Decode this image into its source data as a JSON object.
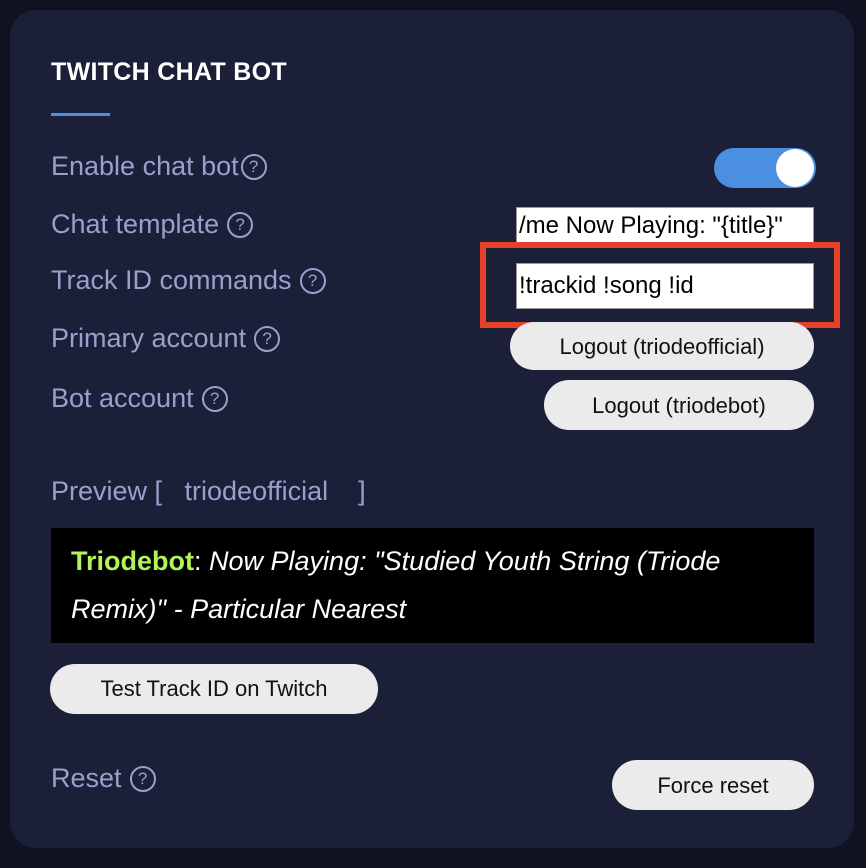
{
  "panel": {
    "title": "TWITCH CHAT BOT"
  },
  "settings": {
    "enable_chat_bot": {
      "label": "Enable chat bot",
      "enabled": true
    },
    "chat_template": {
      "label": "Chat template",
      "value": "/me Now Playing: \"{title}\""
    },
    "track_id_commands": {
      "label": "Track ID commands",
      "value": "!trackid !song !id"
    },
    "primary_account": {
      "label": "Primary account",
      "button_label": "Logout (triodeofficial)"
    },
    "bot_account": {
      "label": "Bot account",
      "button_label": "Logout (triodebot)"
    }
  },
  "preview": {
    "label": "Preview [   triodeofficial    ]",
    "bot_name": "Triodebot",
    "separator": ": ",
    "message": "Now Playing: \"Studied Youth String (Triode Remix)\" - Particular Nearest"
  },
  "test_button_label": "Test Track ID on Twitch",
  "reset": {
    "label": "Reset",
    "button_label": "Force reset"
  },
  "help_icon_glyph": "?",
  "colors": {
    "panel_bg": "#1c1f38",
    "accent": "#4a8fe0",
    "label": "#9aa0cc",
    "bot_name": "#b2f25a",
    "highlight": "#e5402a"
  }
}
